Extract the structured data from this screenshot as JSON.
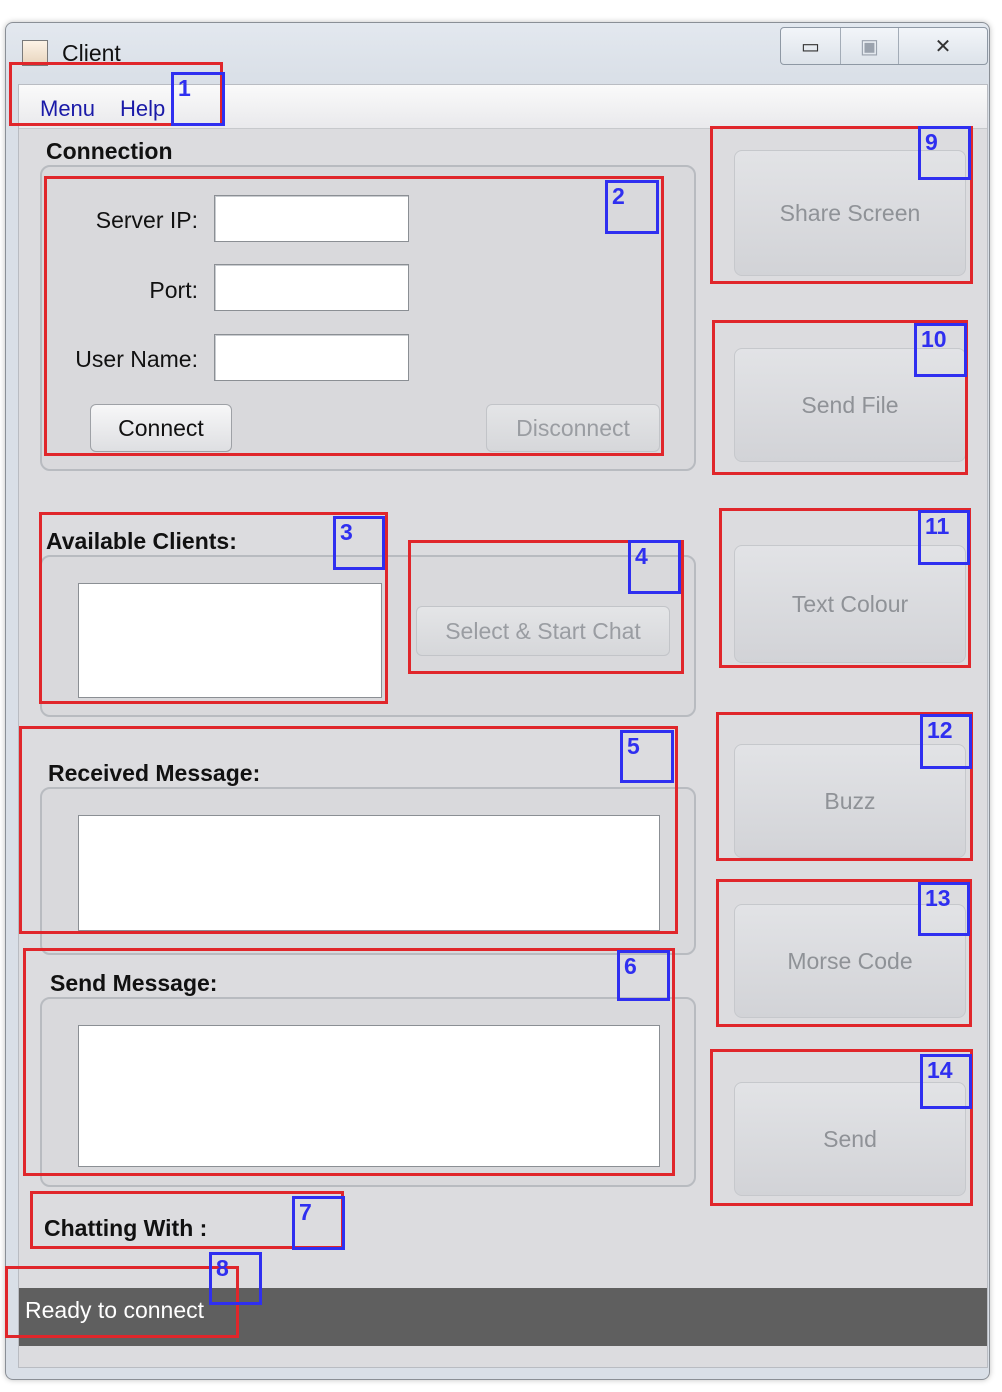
{
  "window": {
    "title": "Client",
    "controls": {
      "minimize": "▭",
      "maximize": "▣",
      "close": "✕"
    }
  },
  "menubar": {
    "items": [
      "Menu",
      "Help"
    ]
  },
  "connection": {
    "title": "Connection",
    "server_ip_label": "Server IP:",
    "server_ip_value": "",
    "port_label": "Port:",
    "port_value": "",
    "username_label": "User Name:",
    "username_value": "",
    "connect_label": "Connect",
    "disconnect_label": "Disconnect"
  },
  "available_clients": {
    "title": "Available Clients:",
    "select_start_chat_label": "Select & Start Chat"
  },
  "received_message": {
    "title": "Received Message:",
    "value": ""
  },
  "send_message": {
    "title": "Send Message:",
    "value": ""
  },
  "chatting_with": {
    "label": "Chatting With :"
  },
  "status": {
    "text": "Ready to connect"
  },
  "side_buttons": {
    "share_screen": "Share Screen",
    "send_file": "Send File",
    "text_colour": "Text Colour",
    "buzz": "Buzz",
    "morse_code": "Morse Code",
    "send": "Send"
  },
  "annotations": [
    "1",
    "2",
    "3",
    "4",
    "5",
    "6",
    "7",
    "8",
    "9",
    "10",
    "11",
    "12",
    "13",
    "14"
  ],
  "colors": {
    "annotation_red": "#e0262b",
    "annotation_blue": "#2f2ff0",
    "menu_text": "#1a1aa8",
    "status_bar": "#5f5f5f"
  }
}
